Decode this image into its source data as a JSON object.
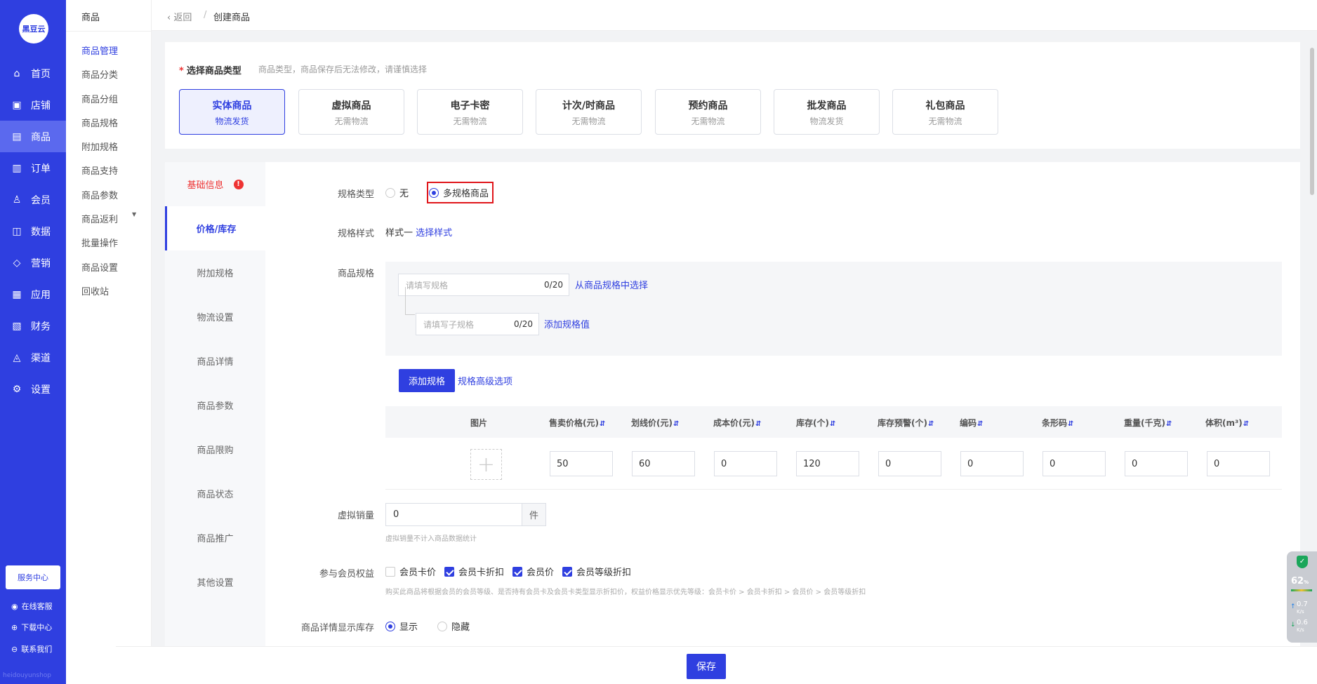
{
  "brand": {
    "logo_text": "黑豆云",
    "footer_text": "heidouyunshop"
  },
  "nav": [
    {
      "label": "首页",
      "icon": "home-icon",
      "glyph": "⌂"
    },
    {
      "label": "店铺",
      "icon": "store-icon",
      "glyph": "▣"
    },
    {
      "label": "商品",
      "icon": "goods-icon",
      "glyph": "▤"
    },
    {
      "label": "订单",
      "icon": "order-icon",
      "glyph": "▥"
    },
    {
      "label": "会员",
      "icon": "member-icon",
      "glyph": "♙"
    },
    {
      "label": "数据",
      "icon": "data-icon",
      "glyph": "◫"
    },
    {
      "label": "营销",
      "icon": "tag-icon",
      "glyph": "◇"
    },
    {
      "label": "应用",
      "icon": "app-icon",
      "glyph": "▦"
    },
    {
      "label": "财务",
      "icon": "finance-icon",
      "glyph": "▧"
    },
    {
      "label": "渠道",
      "icon": "channel-icon",
      "glyph": "◬"
    },
    {
      "label": "设置",
      "icon": "settings-icon",
      "glyph": "⚙"
    }
  ],
  "side_bottom": {
    "service": "服务中心",
    "online": "在线客服",
    "download": "下载中心",
    "contact": "联系我们"
  },
  "submenu": {
    "title": "商品",
    "items": [
      "商品管理",
      "商品分类",
      "商品分组",
      "商品规格",
      "附加规格",
      "商品支持",
      "商品参数",
      "商品返利",
      "批量操作",
      "商品设置",
      "回收站"
    ]
  },
  "header": {
    "back": "返回",
    "separator": "/",
    "crumb": "创建商品"
  },
  "type_section": {
    "label": "选择商品类型",
    "hint": "商品类型，商品保存后无法修改，请谨慎选择",
    "types": [
      {
        "name": "实体商品",
        "desc": "物流发货"
      },
      {
        "name": "虚拟商品",
        "desc": "无需物流"
      },
      {
        "name": "电子卡密",
        "desc": "无需物流"
      },
      {
        "name": "计次/时商品",
        "desc": "无需物流"
      },
      {
        "name": "预约商品",
        "desc": "无需物流"
      },
      {
        "name": "批发商品",
        "desc": "物流发货"
      },
      {
        "name": "礼包商品",
        "desc": "无需物流"
      }
    ]
  },
  "tabs": [
    "基础信息",
    "价格/库存",
    "附加规格",
    "物流设置",
    "商品详情",
    "商品参数",
    "商品限购",
    "商品状态",
    "商品推广",
    "其他设置"
  ],
  "tab_error_mark": "!",
  "form": {
    "spec_type": {
      "label": "规格类型",
      "opt_none": "无",
      "opt_multi": "多规格商品"
    },
    "spec_style": {
      "label": "规格样式",
      "value": "样式一",
      "link": "选择样式"
    },
    "spec": {
      "label": "商品规格",
      "spec_placeholder": "请填写规格",
      "spec_count": "0/20",
      "spec_link": "从商品规格中选择",
      "sub_placeholder": "请填写子规格",
      "sub_count": "0/20",
      "sub_link": "添加规格值",
      "add_button": "添加规格",
      "advanced": "规格高级选项"
    },
    "table": {
      "headers": [
        "图片",
        "售卖价格(元)",
        "划线价(元)",
        "成本价(元)",
        "库存(个)",
        "库存预警(个)",
        "编码",
        "条形码",
        "重量(千克)",
        "体积(m³)"
      ],
      "sort_mark": "⇵",
      "plus_mark": "+",
      "row": [
        "50",
        "60",
        "0",
        "120",
        "0",
        "0",
        "0",
        "0",
        "0"
      ]
    },
    "virtual_sales": {
      "label": "虚拟销量",
      "value": "0",
      "unit": "件",
      "hint": "虚拟销量不计入商品数据统计"
    },
    "member": {
      "label": "参与会员权益",
      "options": [
        {
          "label": "会员卡价",
          "checked": false
        },
        {
          "label": "会员卡折扣",
          "checked": true
        },
        {
          "label": "会员价",
          "checked": true
        },
        {
          "label": "会员等级折扣",
          "checked": true
        }
      ],
      "hint": "购买此商品将根据会员的会员等级、是否持有会员卡及会员卡类型显示折扣价，权益价格显示优先等级：会员卡价 > 会员卡折扣 > 会员价 > 会员等级折扣"
    },
    "stock_display": {
      "label": "商品详情显示库存",
      "show": "显示",
      "hide": "隐藏"
    }
  },
  "footer": {
    "save": "保存"
  },
  "widget": {
    "pct": "62",
    "pct_unit": "%",
    "up": "0.7",
    "down": "0.6",
    "unit": "K/s",
    "up_arrow": "↑",
    "down_arrow": "↓",
    "shield_mark": "✓"
  },
  "colors": {
    "primary": "#2f3fe0",
    "highlight": "#e0161b"
  }
}
